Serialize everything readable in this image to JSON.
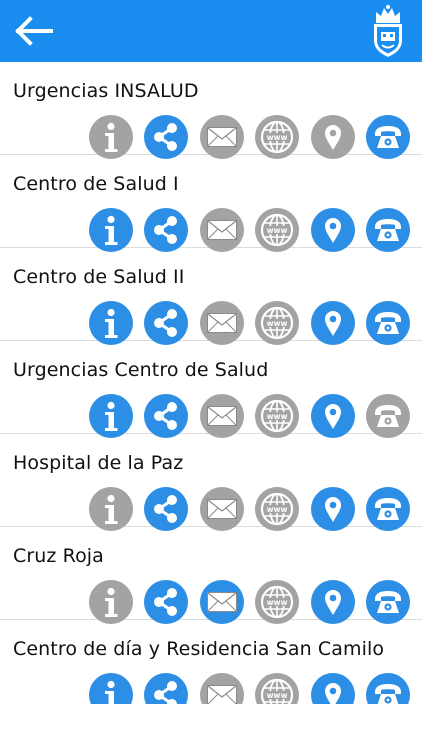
{
  "colors": {
    "header": "#1a8ef0",
    "active": "#2d8ee6",
    "inactive": "#a3a3a3"
  },
  "header": {
    "back_icon": "arrow-left-icon",
    "logo": "municipal-crest"
  },
  "rows": [
    {
      "title": "Urgencias INSALUD",
      "icons": {
        "info": false,
        "share": true,
        "email": false,
        "web": false,
        "location": false,
        "phone": true
      }
    },
    {
      "title": "Centro de Salud I",
      "icons": {
        "info": true,
        "share": true,
        "email": false,
        "web": false,
        "location": true,
        "phone": true
      }
    },
    {
      "title": "Centro de Salud II",
      "icons": {
        "info": true,
        "share": true,
        "email": false,
        "web": false,
        "location": true,
        "phone": true
      }
    },
    {
      "title": "Urgencias Centro de Salud",
      "icons": {
        "info": true,
        "share": true,
        "email": false,
        "web": false,
        "location": true,
        "phone": false
      }
    },
    {
      "title": "Hospital de la Paz",
      "icons": {
        "info": false,
        "share": true,
        "email": false,
        "web": false,
        "location": true,
        "phone": true
      }
    },
    {
      "title": "Cruz Roja",
      "icons": {
        "info": false,
        "share": true,
        "email": true,
        "web": false,
        "location": true,
        "phone": true
      }
    },
    {
      "title": "Centro de día y Residencia  San Camilo",
      "icons": {
        "info": true,
        "share": true,
        "email": false,
        "web": false,
        "location": true,
        "phone": true
      }
    }
  ]
}
